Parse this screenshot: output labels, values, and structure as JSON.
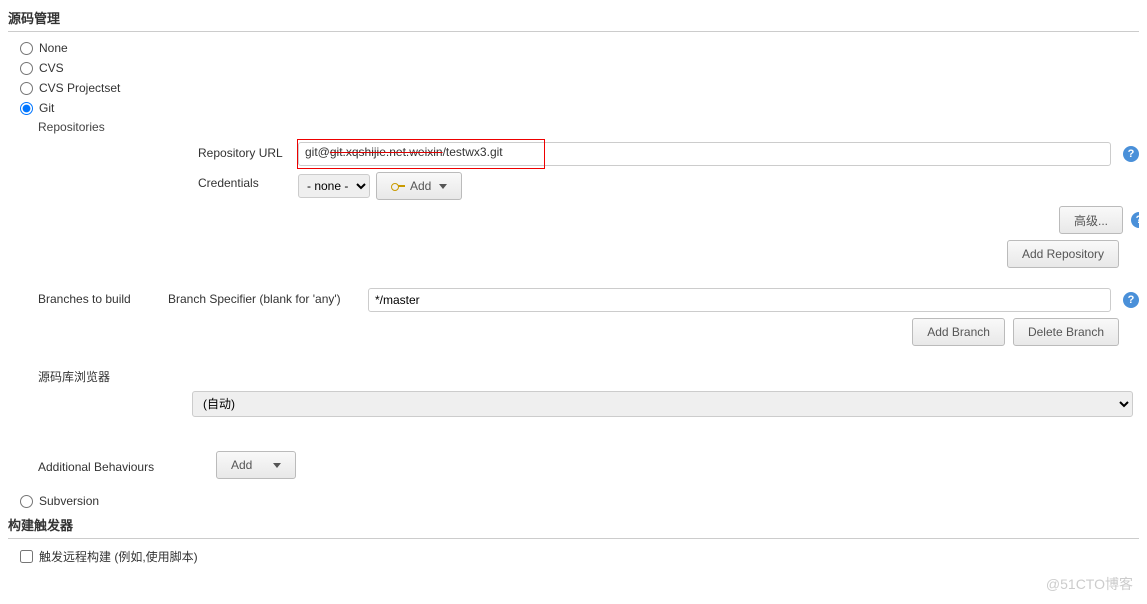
{
  "sections": {
    "scm": "源码管理",
    "triggers": "构建触发器"
  },
  "scm": {
    "options": {
      "none": "None",
      "cvs": "CVS",
      "cvs_projectset": "CVS Projectset",
      "git": "Git",
      "subversion": "Subversion"
    },
    "git": {
      "repositories_label": "Repositories",
      "repo_url_label": "Repository URL",
      "repo_url_prefix": "git@",
      "repo_url_redacted": "git.xqshijie.net.weixin",
      "repo_url_suffix": "/testwx3.git",
      "credentials_label": "Credentials",
      "credentials_value": "- none -",
      "add_button": "Add",
      "advanced_button": "高级...",
      "add_repository_button": "Add Repository",
      "branches_label": "Branches to build",
      "branch_specifier_label": "Branch Specifier (blank for 'any')",
      "branch_specifier_value": "*/master",
      "add_branch_button": "Add Branch",
      "delete_branch_button": "Delete Branch",
      "repo_browser_label": "源码库浏览器",
      "repo_browser_value": "(自动)",
      "additional_behaviours_label": "Additional Behaviours",
      "additional_add_button": "Add"
    }
  },
  "triggers": {
    "remote_build": "触发远程构建 (例如,使用脚本)"
  },
  "watermark": "@51CTO博客"
}
